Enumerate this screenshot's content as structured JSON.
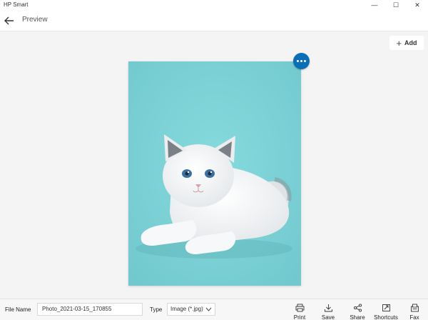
{
  "window": {
    "title": "HP Smart",
    "controls": {
      "minimize": "—",
      "maximize": "☐",
      "close": "✕"
    }
  },
  "nav": {
    "back_icon": "arrow-left-icon",
    "title": "Preview"
  },
  "toolbar": {
    "add_label": "Add",
    "add_icon": "plus-icon",
    "more_icon": "ellipsis-icon"
  },
  "preview": {
    "background_color": "#7ed3d6"
  },
  "bottom": {
    "file_name_label": "File Name",
    "file_name_value": "Photo_2021-03-15_170855",
    "type_label": "Type",
    "type_value": "Image (*.jpg)",
    "actions": [
      {
        "label": "Print",
        "icon": "printer-icon"
      },
      {
        "label": "Save",
        "icon": "save-icon"
      },
      {
        "label": "Share",
        "icon": "share-icon"
      },
      {
        "label": "Shortcuts",
        "icon": "shortcuts-icon"
      },
      {
        "label": "Fax",
        "icon": "fax-icon"
      }
    ]
  },
  "colors": {
    "accent": "#0b6fb8",
    "preview_bg": "#7ed3d6"
  }
}
